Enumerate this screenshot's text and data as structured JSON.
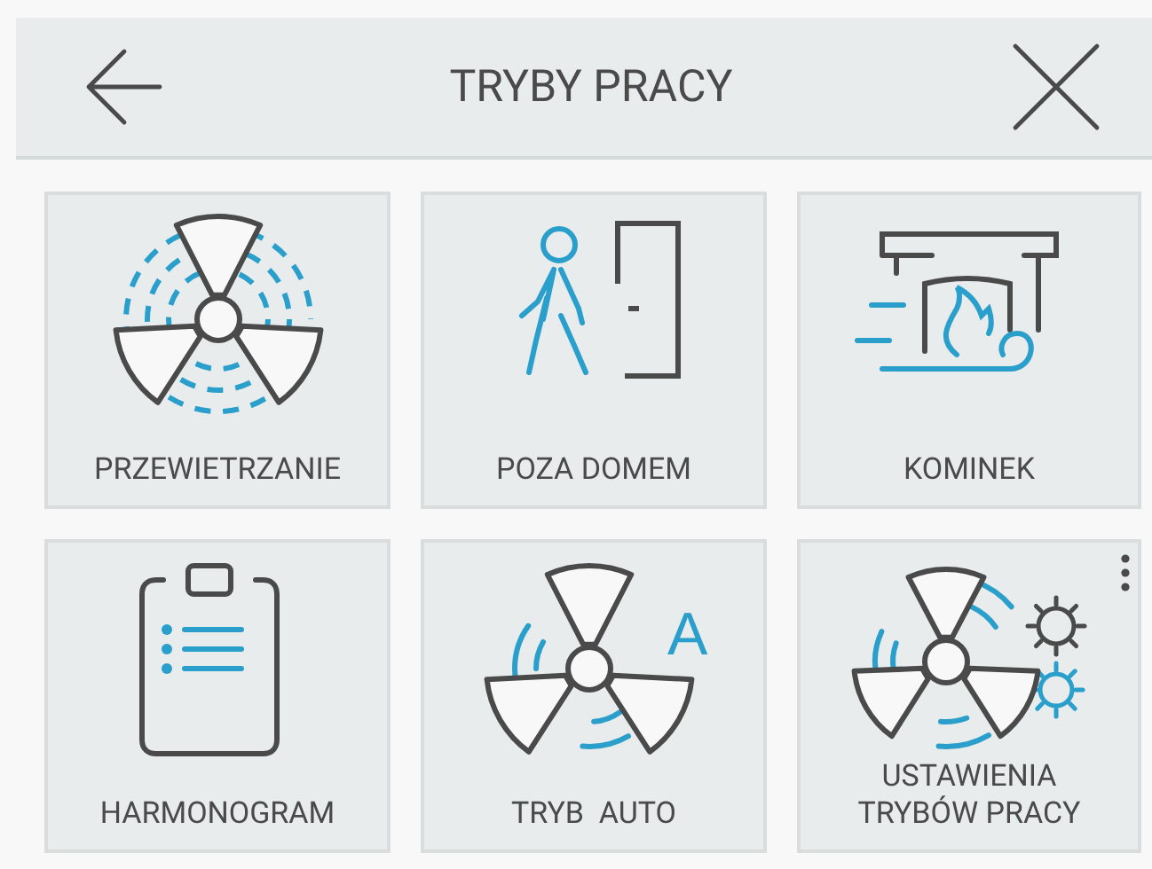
{
  "header": {
    "title": "TRYBY PRACY"
  },
  "tiles": [
    {
      "label": "PRZEWIETRZANIE",
      "kind": "airing"
    },
    {
      "label": "POZA DOMEM",
      "kind": "away"
    },
    {
      "label": "KOMINEK",
      "kind": "fireplace"
    },
    {
      "label": "HARMONOGRAM",
      "kind": "schedule"
    },
    {
      "label": "TRYB  AUTO",
      "kind": "auto",
      "letter": "A"
    },
    {
      "label": "USTAWIENIA\nTRYBÓW PRACY",
      "kind": "settings",
      "menu": true
    }
  ]
}
